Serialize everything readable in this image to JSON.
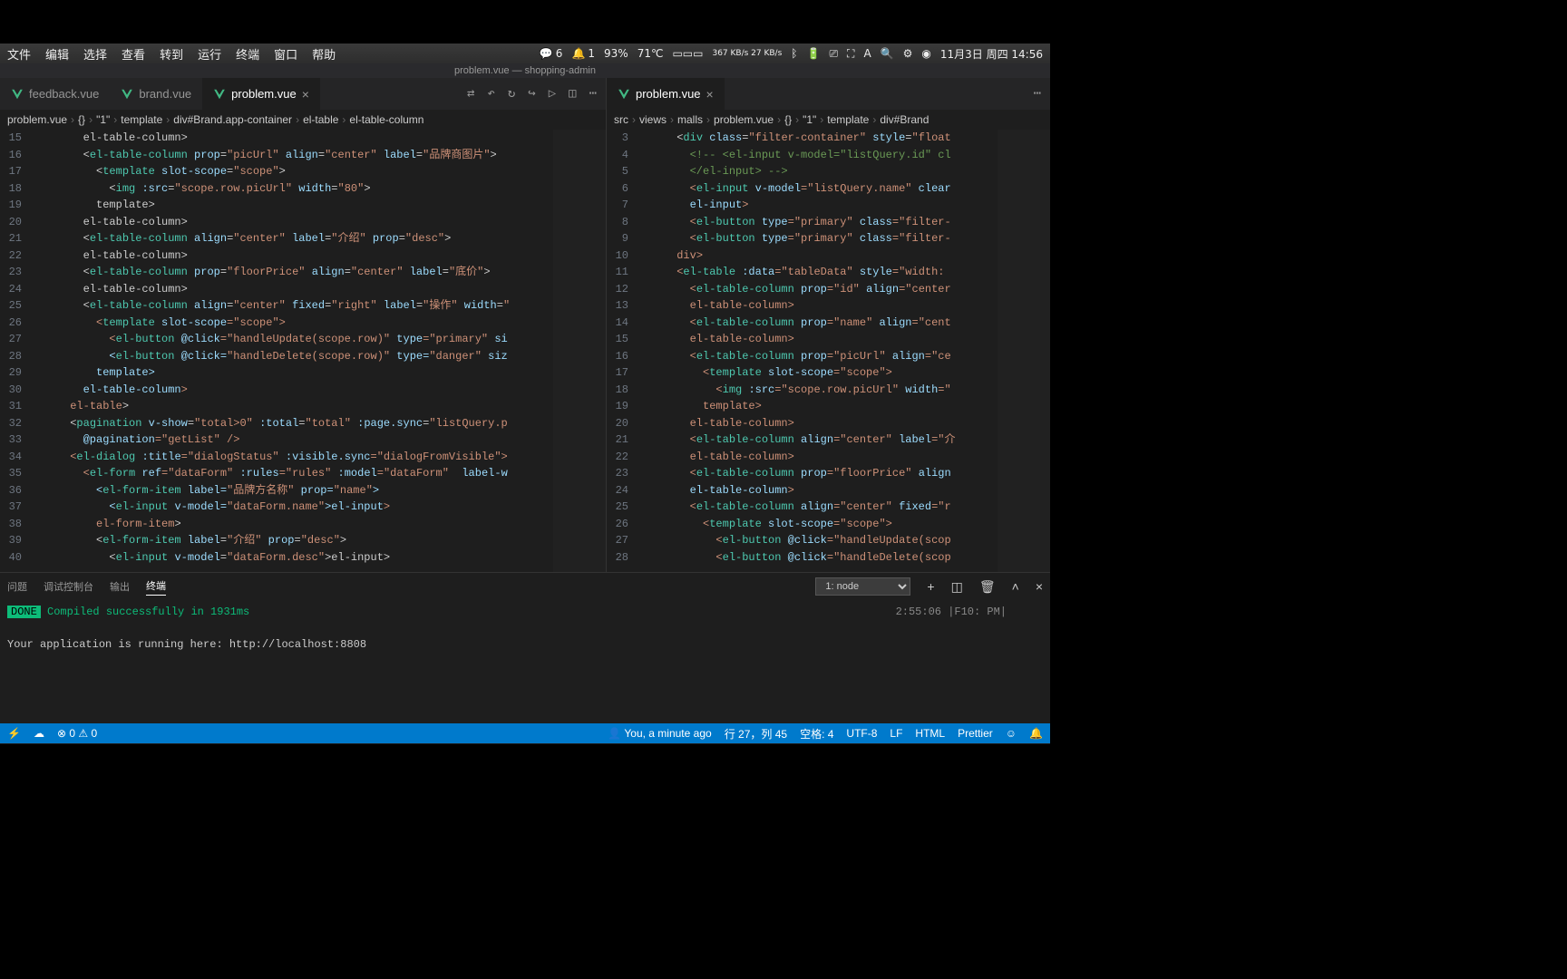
{
  "mac_menu": {
    "items": [
      "文件",
      "编辑",
      "选择",
      "查看",
      "转到",
      "运行",
      "终端",
      "窗口",
      "帮助"
    ],
    "right": {
      "msg_count": "6",
      "noti_count": "1",
      "cpu": "93%",
      "temp": "71℃",
      "net": "367 KB/s\n27 KB/s",
      "date": "11月3日 周四 14:56"
    }
  },
  "window_title": "problem.vue — shopping-admin",
  "tabs_left": {
    "t1": "feedback.vue",
    "t2": "brand.vue",
    "t3": "problem.vue"
  },
  "tabs_right": {
    "t1": "problem.vue"
  },
  "breadcrumb_left": {
    "p1": "problem.vue",
    "p2": "{}",
    "p3": "\"1\"",
    "p4": "template",
    "p5": "div#Brand.app-container",
    "p6": "el-table",
    "p7": "el-table-column"
  },
  "breadcrumb_right": {
    "p1": "src",
    "p2": "views",
    "p3": "malls",
    "p4": "problem.vue",
    "p5": "{}",
    "p6": "\"1\"",
    "p7": "template",
    "p8": "div#Brand"
  },
  "code_left": {
    "lines": [
      {
        "n": 15,
        "html": "        </<span class='tag'>el-table-column</span>>"
      },
      {
        "n": 16,
        "html": "        <<span class='tag'>el-table-column</span> <span class='attr'>prop</span>=<span class='str'>\"picUrl\"</span> <span class='attr'>align</span>=<span class='str'>\"center\"</span> <span class='attr'>label</span>=<span class='str'>\"品牌商图片\"</span>>"
      },
      {
        "n": 17,
        "html": "          <<span class='tag'>template</span> <span class='attr'>slot-scope</span>=<span class='str'>\"scope\"</span>>"
      },
      {
        "n": 18,
        "html": "            <<span class='tag'>img</span> <span class='attr'>:src</span>=<span class='str'>\"scope.row.picUrl\"</span> <span class='attr'>width</span>=<span class='str'>\"80\"</span>>"
      },
      {
        "n": 19,
        "html": "          </<span class='tag'>template</span>>"
      },
      {
        "n": 20,
        "html": "        </<span class='tag'>el-table-column</span>>"
      },
      {
        "n": 21,
        "html": "        <<span class='tag'>el-table-column</span> <span class='attr'>align</span>=<span class='str'>\"center\"</span> <span class='attr'>label</span>=<span class='str'>\"介绍\"</span> <span class='attr'>prop</span>=<span class='str'>\"desc\"</span>>"
      },
      {
        "n": 22,
        "html": "        </<span class='tag'>el-table-column</span>>"
      },
      {
        "n": 23,
        "html": "        <<span class='tag'>el-table-column</span> <span class='attr'>prop</span>=<span class='str'>\"floorPrice\"</span> <span class='attr'>align</span>=<span class='str'>\"center\"</span> <span class='attr'>label</span>=<span class='str'>\"底价\"</span>>"
      },
      {
        "n": 24,
        "html": "        </<span class='tag'>el-table-column</span>>"
      },
      {
        "n": 25,
        "html": "        <<span class='tag'>el-table-column</span> <span class='attr'>align</span>=<span class='str'>\"center\"</span> <span class='attr'>fixed</span>=<span class='str'>\"right\"</span> <span class='attr'>label</span>=<span class='str'>\"操作\"</span> <span class='attr'>width</span>=<span class='str'>\""
      },
      {
        "n": 26,
        "html": "          <<span class='tag'>template</span> <span class='attr'>slot-scope</span>=<span class='str'>\"scope\"</span>>"
      },
      {
        "n": 27,
        "html": "            <<span class='tag'>el-button</span> <span class='attr'>@click</span>=<span class='str'>\"handleUpdate(scope.row)\"</span> <span class='attr'>type</span>=<span class='str'>\"primary\"</span> <span class='attr'>si"
      },
      {
        "n": 28,
        "html": "            <<span class='tag'>el-button</span> <span class='attr'>@click</span>=<span class='str'>\"handleDelete(scope.row)\"</span> <span class='attr'>type</span>=<span class='str'>\"danger\"</span> <span class='attr'>siz"
      },
      {
        "n": 29,
        "html": "          </<span class='tag'>template</span>>"
      },
      {
        "n": 30,
        "html": "        </<span class='tag'>el-table-column</span>>"
      },
      {
        "n": 31,
        "html": "      </<span class='tag'>el-table</span>>"
      },
      {
        "n": 32,
        "html": "      <<span class='tag'>pagination</span> <span class='attr'>v-show</span>=<span class='str'>\"total>0\"</span> <span class='attr'>:total</span>=<span class='str'>\"total\"</span> <span class='attr'>:page.sync</span>=<span class='str'>\"listQuery.p"
      },
      {
        "n": 33,
        "html": "        <span class='attr'>@pagination</span>=<span class='str'>\"getList\"</span> />"
      },
      {
        "n": 34,
        "html": "      <<span class='tag'>el-dialog</span> <span class='attr'>:title</span>=<span class='str'>\"dialogStatus\"</span> <span class='attr'>:visible.sync</span>=<span class='str'>\"dialogFromVisible\"</span>>"
      },
      {
        "n": 35,
        "html": "        <<span class='tag'>el-form</span> <span class='attr'>ref</span>=<span class='str'>\"dataForm\"</span> <span class='attr'>:rules</span>=<span class='str'>\"rules\"</span> <span class='attr'>:model</span>=<span class='str'>\"dataForm\"</span>  <span class='attr'>label-w"
      },
      {
        "n": 36,
        "html": "          <<span class='tag'>el-form-item</span> <span class='attr'>label</span>=<span class='str'>\"品牌方名称\"</span> <span class='attr'>prop</span>=<span class='str'>\"name\"</span>>"
      },
      {
        "n": 37,
        "html": "            <<span class='tag'>el-input</span> <span class='attr'>v-model</span>=<span class='str'>\"dataForm.name\"</span>></<span class='tag'>el-input</span>>"
      },
      {
        "n": 38,
        "html": "          </<span class='tag'>el-form-item</span>>"
      },
      {
        "n": 39,
        "html": "          <<span class='tag'>el-form-item</span> <span class='attr'>label</span>=<span class='str'>\"介绍\"</span> <span class='attr'>prop</span>=<span class='str'>\"desc\"</span>>"
      },
      {
        "n": 40,
        "html": "            <<span class='tag'>el-input</span> <span class='attr'>v-model</span>=<span class='str'>\"dataForm.desc\"</span>></<span class='tag'>el-input</span>>"
      }
    ]
  },
  "code_right": {
    "lines": [
      {
        "n": 3,
        "html": "      <<span class='tag'>div</span> <span class='attr'>class</span>=<span class='str'>\"filter-container\"</span> <span class='attr'>style</span>=<span class='str'>\"float"
      },
      {
        "n": 4,
        "html": "        <span class='cmt'>&lt;!-- &lt;el-input v-model=\"listQuery.id\" cl</span>"
      },
      {
        "n": 5,
        "html": "        <span class='cmt'>&lt;/el-input&gt; --&gt;</span>"
      },
      {
        "n": 6,
        "html": "        <<span class='tag'>el-input</span> <span class='attr'>v-model</span>=<span class='str'>\"listQuery.name\"</span> <span class='attr'>clear"
      },
      {
        "n": 7,
        "html": "        </<span class='tag'>el-input</span>>"
      },
      {
        "n": 8,
        "html": "        <<span class='tag'>el-button</span> <span class='attr'>type</span>=<span class='str'>\"primary\"</span> <span class='attr'>class</span>=<span class='str'>\"filter-"
      },
      {
        "n": 9,
        "html": "        <<span class='tag'>el-button</span> <span class='attr'>type</span>=<span class='str'>\"primary\"</span> <span class='attr'>class</span>=<span class='str'>\"filter-"
      },
      {
        "n": 10,
        "html": "      </<span class='tag'>div</span>>"
      },
      {
        "n": 11,
        "html": "      <<span class='tag'>el-table</span> <span class='attr'>:data</span>=<span class='str'>\"tableData\"</span> <span class='attr'>style</span>=<span class='str'>\"width:"
      },
      {
        "n": 12,
        "html": "        <<span class='tag'>el-table-column</span> <span class='attr'>prop</span>=<span class='str'>\"id\"</span> <span class='attr'>align</span>=<span class='str'>\"center"
      },
      {
        "n": 13,
        "html": "        </<span class='tag'>el-table-column</span>>"
      },
      {
        "n": 14,
        "html": "        <<span class='tag'>el-table-column</span> <span class='attr'>prop</span>=<span class='str'>\"name\"</span> <span class='attr'>align</span>=<span class='str'>\"cent"
      },
      {
        "n": 15,
        "html": "        </<span class='tag'>el-table-column</span>>"
      },
      {
        "n": 16,
        "html": "        <<span class='tag'>el-table-column</span> <span class='attr'>prop</span>=<span class='str'>\"picUrl\"</span> <span class='attr'>align</span>=<span class='str'>\"ce"
      },
      {
        "n": 17,
        "html": "          <<span class='tag'>template</span> <span class='attr'>slot-scope</span>=<span class='str'>\"scope\"</span>>"
      },
      {
        "n": 18,
        "html": "            <<span class='tag'>img</span> <span class='attr'>:src</span>=<span class='str'>\"scope.row.picUrl\"</span> <span class='attr'>width</span>=<span class='str'>\""
      },
      {
        "n": 19,
        "html": "          </<span class='tag'>template</span>>"
      },
      {
        "n": 20,
        "html": "        </<span class='tag'>el-table-column</span>>"
      },
      {
        "n": 21,
        "html": "        <<span class='tag'>el-table-column</span> <span class='attr'>align</span>=<span class='str'>\"center\"</span> <span class='attr'>label</span>=<span class='str'>\"介"
      },
      {
        "n": 22,
        "html": "        </<span class='tag'>el-table-column</span>>"
      },
      {
        "n": 23,
        "html": "        <<span class='tag'>el-table-column</span> <span class='attr'>prop</span>=<span class='str'>\"floorPrice\"</span> <span class='attr'>align"
      },
      {
        "n": 24,
        "html": "        </<span class='tag'>el-table-column</span>>"
      },
      {
        "n": 25,
        "html": "        <<span class='tag'>el-table-column</span> <span class='attr'>align</span>=<span class='str'>\"center\"</span> <span class='attr'>fixed</span>=<span class='str'>\"r"
      },
      {
        "n": 26,
        "html": "          <<span class='tag'>template</span> <span class='attr'>slot-scope</span>=<span class='str'>\"scope\"</span>>"
      },
      {
        "n": 27,
        "html": "            <<span class='tag'>el-button</span> <span class='attr'>@click</span>=<span class='str'>\"handleUpdate(scop"
      },
      {
        "n": 28,
        "html": "            <<span class='tag'>el-button</span> <span class='attr'>@click</span>=<span class='str'>\"handleDelete(scop"
      }
    ]
  },
  "panel": {
    "tabs": {
      "t1": "问题",
      "t2": "调试控制台",
      "t3": "输出",
      "t4": "终端"
    },
    "select": "1: node",
    "done": "DONE",
    "compiled": " Compiled successfully in 1931ms",
    "running": "  Your application is running here: http://localhost:8808",
    "time": "2:55:06 |F10: PM|"
  },
  "status": {
    "errors": "0",
    "warnings": "0",
    "blame": "You, a minute ago",
    "pos": "行 27，列 45",
    "spaces": "空格: 4",
    "encoding": "UTF-8",
    "eol": "LF",
    "lang": "HTML",
    "prettier": "Prettier"
  }
}
